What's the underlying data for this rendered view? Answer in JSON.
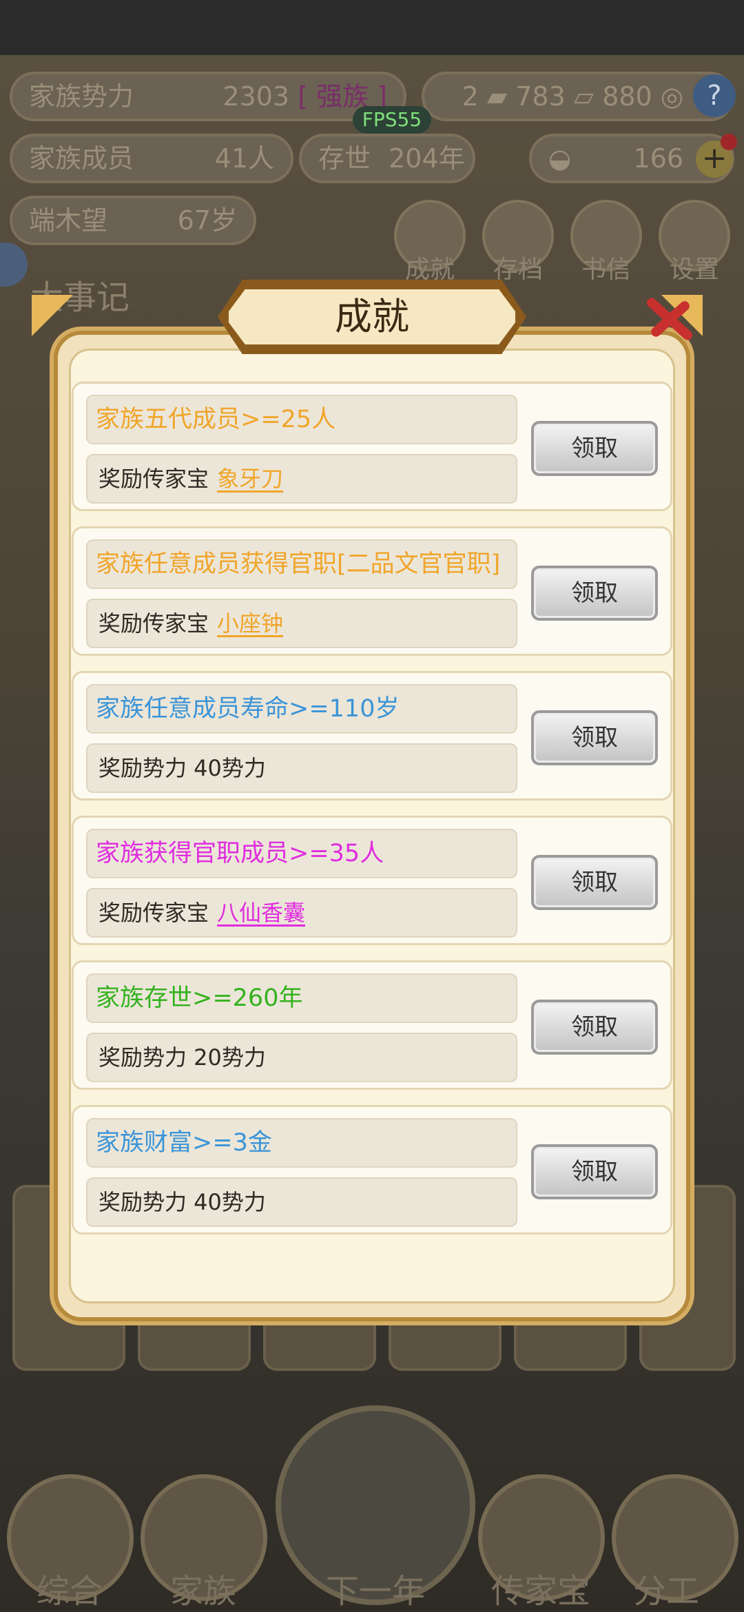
{
  "header": {
    "family_power_label": "家族势力",
    "family_power_value": "2303",
    "family_power_tag": "[ 强族 ]",
    "fps": "FPS55",
    "currency_1": "2",
    "currency_2": "783",
    "currency_3": "880",
    "members_label": "家族成员",
    "members_value": "41人",
    "existence_label": "存世",
    "existence_value": "204年",
    "gold_value": "166",
    "leader_name": "端木望",
    "leader_age": "67岁"
  },
  "menu": [
    {
      "label": "成就"
    },
    {
      "label": "存档"
    },
    {
      "label": "书信"
    },
    {
      "label": "设置"
    }
  ],
  "background_text": {
    "big_events": "大事记"
  },
  "bottom_nav": [
    {
      "label": "综合"
    },
    {
      "label": "家族"
    },
    {
      "label": "下一年"
    },
    {
      "label": "传家宝"
    },
    {
      "label": "分工"
    }
  ],
  "modal": {
    "title": "成就",
    "claim_label": "领取",
    "achievements": [
      {
        "requirement": "家族五代成员>=25人",
        "reward_prefix": "奖励传家宝",
        "reward_item": "象牙刀",
        "color": "#f0a52a"
      },
      {
        "requirement": "家族任意成员获得官职[二品文官官职]",
        "reward_prefix": "奖励传家宝",
        "reward_item": "小座钟",
        "color": "#f0a52a"
      },
      {
        "requirement": "家族任意成员寿命>=110岁",
        "reward_prefix": "奖励势力 40势力",
        "reward_item": "",
        "color": "#3b94d8"
      },
      {
        "requirement": "家族获得官职成员>=35人",
        "reward_prefix": "奖励传家宝",
        "reward_item": "八仙香囊",
        "color": "#e02ce0"
      },
      {
        "requirement": "家族存世>=260年",
        "reward_prefix": "奖励势力 20势力",
        "reward_item": "",
        "color": "#34b21f"
      },
      {
        "requirement": "家族财富>=3金",
        "reward_prefix": "奖励势力 40势力",
        "reward_item": "",
        "color": "#3b94d8"
      }
    ]
  }
}
